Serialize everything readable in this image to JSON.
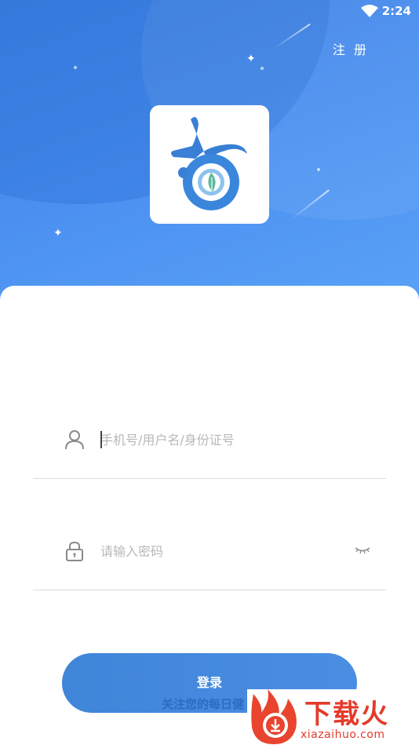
{
  "status_bar": {
    "time": "2:24",
    "wifi_icon": "wifi-icon"
  },
  "header": {
    "register_label": "注 册"
  },
  "login_form": {
    "username": {
      "placeholder": "手机号/用户名/身份证号",
      "value": "",
      "icon": "user-icon"
    },
    "password": {
      "placeholder": "请输入密码",
      "value": "",
      "icon": "lock-icon",
      "toggle_icon": "eye-closed-icon"
    },
    "login_button_label": "登录"
  },
  "footer": {
    "slogan": "关注您的每日健"
  },
  "watermark": {
    "brand": "下载火",
    "url": "xiazaihuo.com"
  },
  "colors": {
    "primary": "#4a8ee3",
    "header_top": "#3b7fe0",
    "header_bottom": "#5aa2f7",
    "watermark_red": "#e43a2a"
  }
}
